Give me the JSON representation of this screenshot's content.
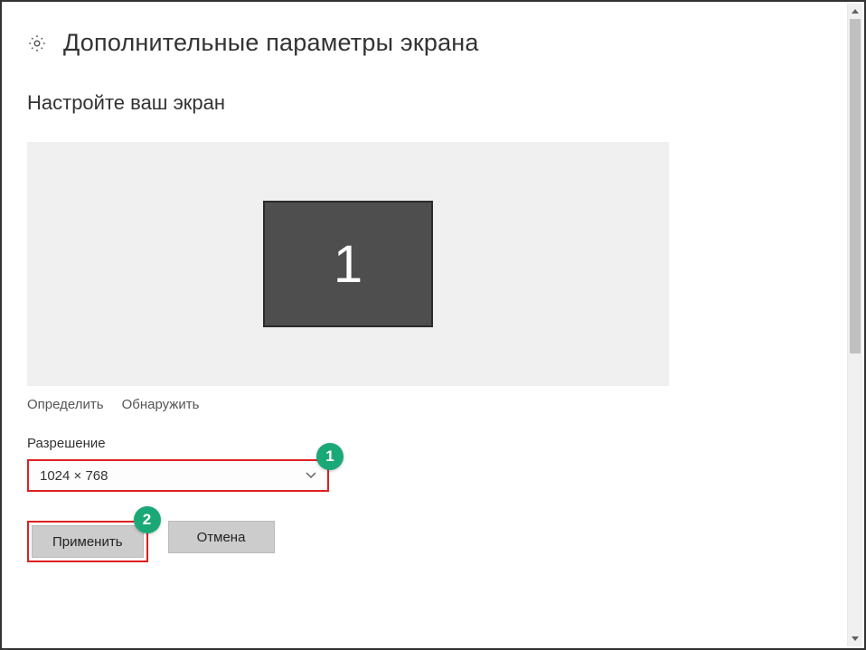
{
  "header": {
    "title": "Дополнительные параметры экрана"
  },
  "section": {
    "heading": "Настройте ваш экран"
  },
  "display": {
    "monitor_number": "1"
  },
  "links": {
    "identify": "Определить",
    "detect": "Обнаружить"
  },
  "resolution": {
    "label": "Разрешение",
    "value": "1024 × 768"
  },
  "buttons": {
    "apply": "Применить",
    "cancel": "Отмена"
  },
  "callouts": {
    "one": "1",
    "two": "2"
  }
}
